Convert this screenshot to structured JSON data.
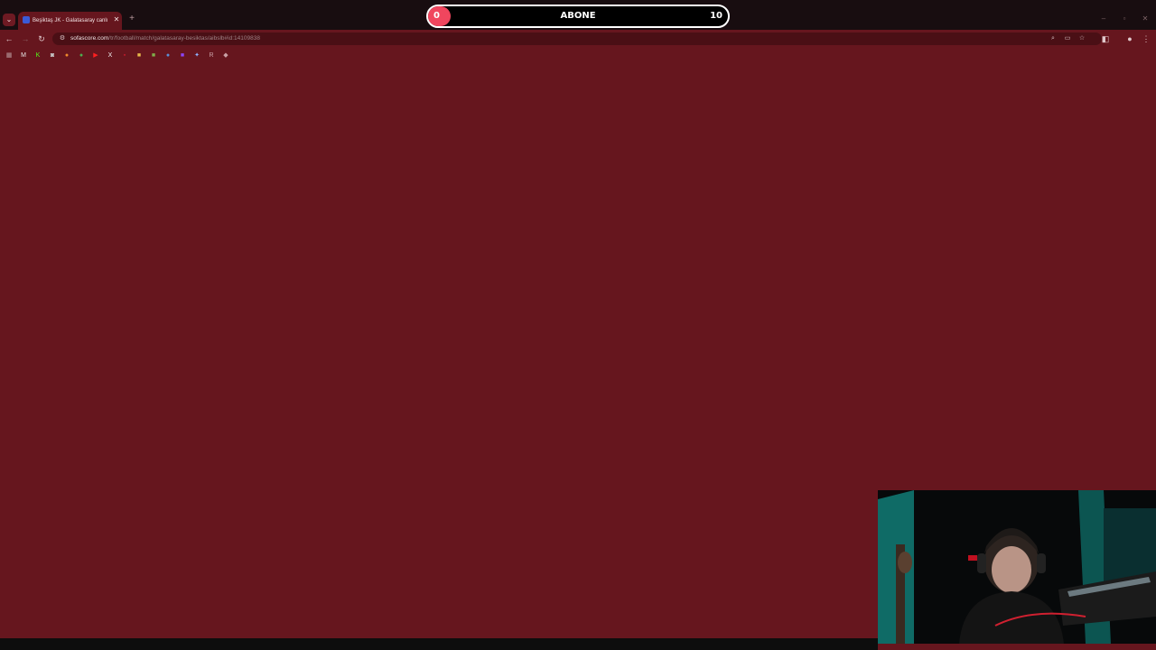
{
  "browser": {
    "tab": {
      "title": "Beşiktaş JK - Galatasaray canlı",
      "close_glyph": "✕"
    },
    "new_tab_glyph": "+",
    "tab_search_glyph": "⌄",
    "url": {
      "host": "sofascore.com",
      "path": "/tr/football/match/galatasaray-besiktas/aibslb#id:14109838"
    },
    "window_controls": [
      "–",
      "▫",
      "✕"
    ],
    "bookmarks": [
      {
        "icon": "apps-icon",
        "glyph": "▦",
        "color": "#b89a9d"
      },
      {
        "icon": "gmail-icon",
        "glyph": "M",
        "color": "#e8e8e8"
      },
      {
        "icon": "kick-icon",
        "glyph": "K",
        "color": "#53fc18"
      },
      {
        "icon": "bookmark-icon-3",
        "glyph": "◙",
        "color": "#c9c9c9"
      },
      {
        "icon": "bookmark-icon-4",
        "glyph": "●",
        "color": "#f08a2c"
      },
      {
        "icon": "bookmark-icon-5",
        "glyph": "●",
        "color": "#4caf50"
      },
      {
        "icon": "youtube-icon",
        "glyph": "▶",
        "color": "#ff2020"
      },
      {
        "icon": "x-icon",
        "glyph": "X",
        "color": "#f0f0f0"
      },
      {
        "icon": "bookmark-icon-8",
        "glyph": "▪",
        "color": "#c21a2a"
      },
      {
        "icon": "folder-icon",
        "glyph": "■",
        "color": "#e6b84a"
      },
      {
        "icon": "bookmark-icon-10",
        "glyph": "■",
        "color": "#7fae4a"
      },
      {
        "icon": "bookmark-icon-11",
        "glyph": "●",
        "color": "#5b8fd6"
      },
      {
        "icon": "twitch-icon",
        "glyph": "■",
        "color": "#8c45f7"
      },
      {
        "icon": "gemini-icon",
        "glyph": "✦",
        "color": "#8fb4ff"
      },
      {
        "icon": "bookmark-icon-14",
        "glyph": "R",
        "color": "#c9a0a5"
      },
      {
        "icon": "bookmark-icon-15",
        "glyph": "◆",
        "color": "#c9a0a5"
      }
    ]
  },
  "overlay": {
    "current": "0",
    "label": "ABONE",
    "goal": "10",
    "progress": 0
  },
  "colors": {
    "page_background": "#66161e",
    "progress_fill": "#f0465e"
  }
}
